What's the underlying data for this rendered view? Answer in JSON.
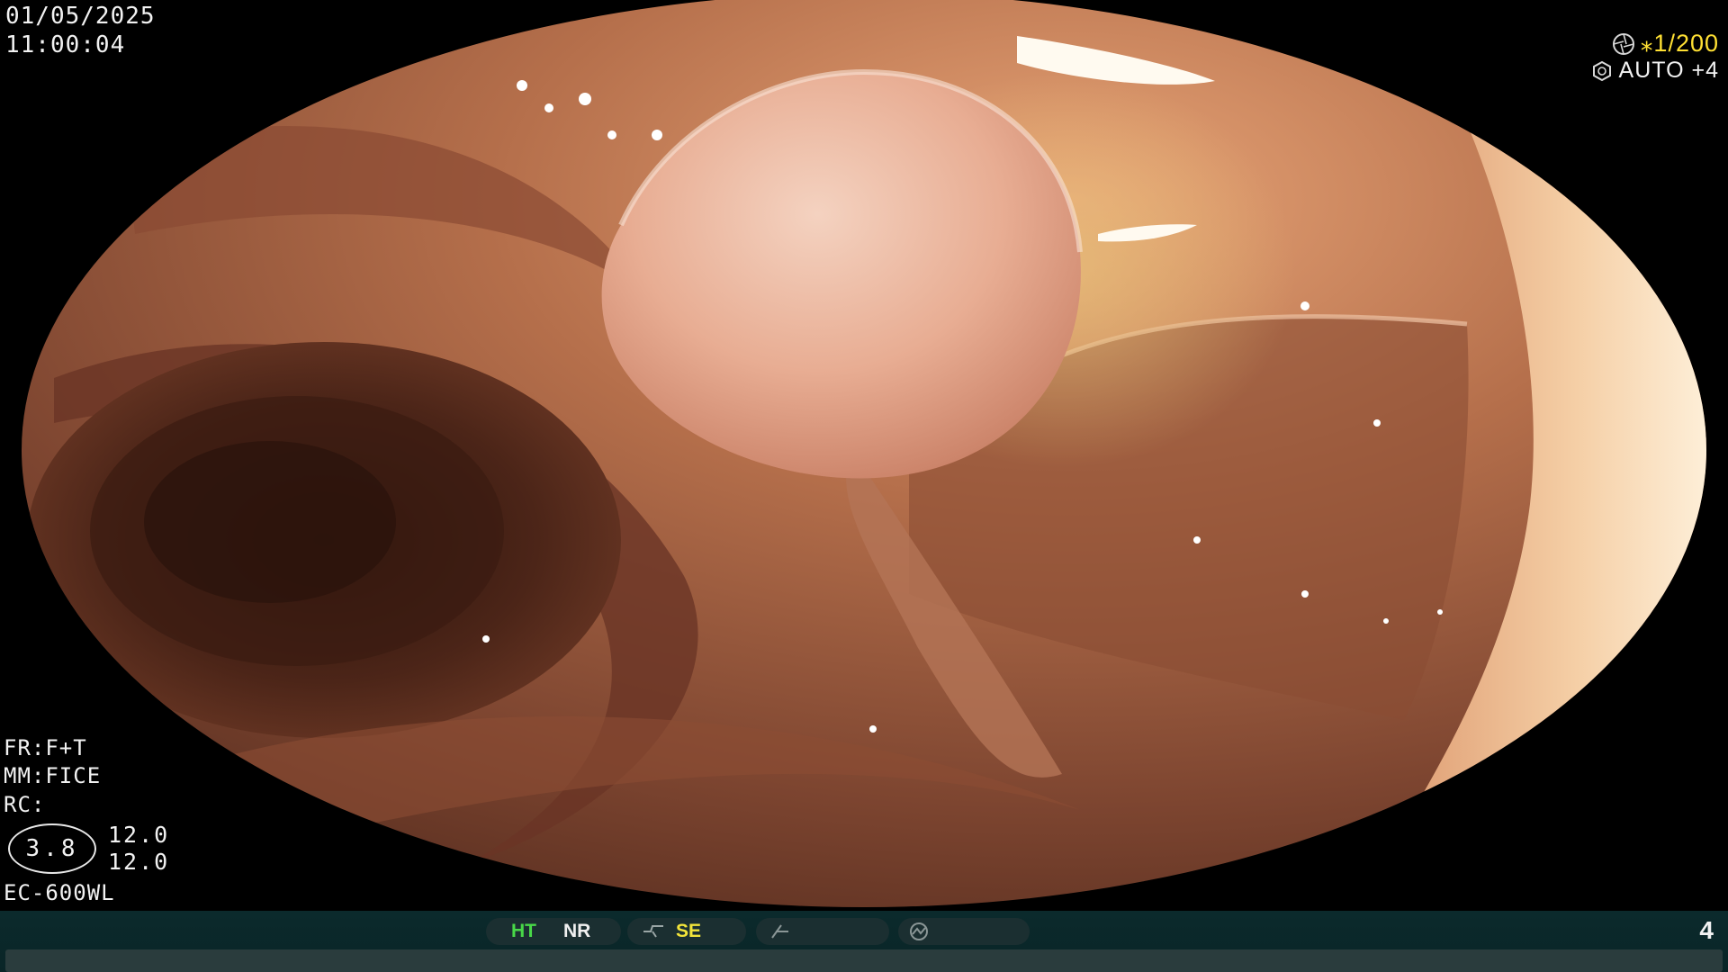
{
  "overlay": {
    "date": "01/05/2025",
    "time": "11:00:04",
    "fr_label": "FR:F+T",
    "mm_label": "MM:FICE",
    "rc_label": "RC:",
    "gain_value": "3.8",
    "gain_top": "12.0",
    "gain_bottom": "12.0",
    "scope_model": "EC-600WL"
  },
  "top_right": {
    "shutter_icon": "shutter-icon",
    "shutter": "⁎1/200",
    "iris_icon": "iris-icon",
    "iris_mode": "AUTO +4"
  },
  "status_bar": {
    "ht_label": "HT",
    "nr_label": "NR",
    "structure_icon": "structure-enhance-icon",
    "se_label": "SE",
    "color_icon": "color-enhance-icon",
    "mode_icon": "mode-icon",
    "page_number": "4"
  },
  "colors": {
    "ht": "#48d848",
    "se": "#f2e43a",
    "shutter": "#ffe033",
    "bar_bg": "#0b2a2c"
  }
}
